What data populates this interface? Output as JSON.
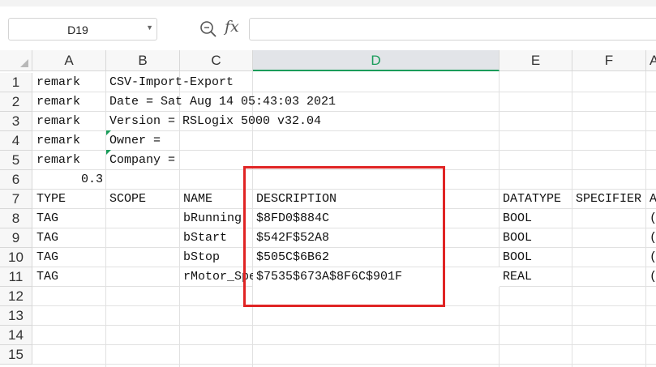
{
  "formula_bar": {
    "cell_reference": "D19",
    "fx_label": "fx",
    "formula_value": ""
  },
  "columns": [
    "A",
    "B",
    "C",
    "D",
    "E",
    "F",
    "A"
  ],
  "selected_column": "D",
  "rows": [
    "1",
    "2",
    "3",
    "4",
    "5",
    "6",
    "7",
    "8",
    "9",
    "10",
    "11",
    "12",
    "13",
    "14",
    "15"
  ],
  "cells": {
    "r1": {
      "a": "remark",
      "b": "CSV-Import-Export"
    },
    "r2": {
      "a": "remark",
      "b": "Date = Sat Aug 14 05:43:03 2021"
    },
    "r3": {
      "a": "remark",
      "b": "Version = RSLogix 5000 v32.04"
    },
    "r4": {
      "a": "remark",
      "b": "Owner ="
    },
    "r5": {
      "a": "remark",
      "b": "Company ="
    },
    "r6": {
      "a": "0.3"
    },
    "r7": {
      "a": "TYPE",
      "b": "SCOPE",
      "c": "NAME",
      "d": "DESCRIPTION",
      "e": "DATATYPE",
      "f": "SPECIFIER",
      "g": "A"
    },
    "r8": {
      "a": "TAG",
      "c": "bRunning",
      "d": "$8FD0$884C",
      "e": "BOOL",
      "g": "("
    },
    "r9": {
      "a": "TAG",
      "c": "bStart",
      "d": "$542F$52A8",
      "e": "BOOL",
      "g": "("
    },
    "r10": {
      "a": "TAG",
      "c": "bStop",
      "d": "$505C$6B62",
      "e": "BOOL",
      "g": "("
    },
    "r11": {
      "a": "TAG",
      "c": "rMotor_Speed",
      "d": "$7535$673A$8F6C$901F",
      "e": "REAL",
      "g": "("
    }
  },
  "colors": {
    "selected_header_text": "#1a9c5a",
    "highlight_box": "#e02424",
    "grid_line": "#e1e1e1"
  }
}
